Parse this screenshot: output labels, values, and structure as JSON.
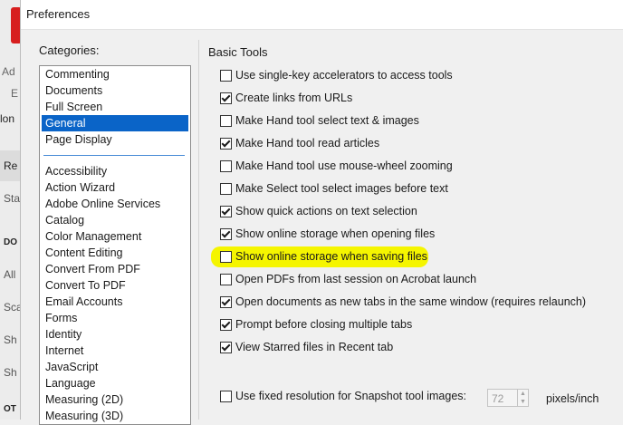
{
  "window": {
    "title": "Preferences"
  },
  "background_app": {
    "fragments": [
      "Ad",
      "E",
      "lon",
      "Re",
      "Sta",
      "DO",
      "All",
      "Sca",
      "Sh",
      "Sh",
      "OT"
    ]
  },
  "categories": {
    "label": "Categories:",
    "top_items": [
      {
        "label": "Commenting",
        "selected": false
      },
      {
        "label": "Documents",
        "selected": false
      },
      {
        "label": "Full Screen",
        "selected": false
      },
      {
        "label": "General",
        "selected": true
      },
      {
        "label": "Page Display",
        "selected": false
      }
    ],
    "items": [
      "Accessibility",
      "Action Wizard",
      "Adobe Online Services",
      "Catalog",
      "Color Management",
      "Content Editing",
      "Convert From PDF",
      "Convert To PDF",
      "Email Accounts",
      "Forms",
      "Identity",
      "Internet",
      "JavaScript",
      "Language",
      "Measuring (2D)",
      "Measuring (3D)"
    ]
  },
  "basic_tools": {
    "title": "Basic Tools",
    "options": [
      {
        "label": "Use single-key accelerators to access tools",
        "checked": false
      },
      {
        "label": "Create links from URLs",
        "checked": true
      },
      {
        "label": "Make Hand tool select text & images",
        "checked": false
      },
      {
        "label": "Make Hand tool read articles",
        "checked": true
      },
      {
        "label": "Make Hand tool use mouse-wheel zooming",
        "checked": false
      },
      {
        "label": "Make Select tool select images before text",
        "checked": false
      },
      {
        "label": "Show quick actions on text selection",
        "checked": true
      },
      {
        "label": "Show online storage when opening files",
        "checked": true
      },
      {
        "label": "Show online storage when saving files",
        "checked": false,
        "highlighted": true
      },
      {
        "label": "Open PDFs from last session on Acrobat launch",
        "checked": false
      },
      {
        "label": "Open documents as new tabs in the same window (requires relaunch)",
        "checked": true
      },
      {
        "label": "Prompt before closing multiple tabs",
        "checked": true
      },
      {
        "label": "View Starred files in Recent tab",
        "checked": true
      }
    ]
  },
  "snapshot": {
    "label": "Use fixed resolution for Snapshot tool images:",
    "checked": false,
    "value": "72",
    "units": "pixels/inch"
  },
  "colors": {
    "selection": "#0a64c8",
    "highlight": "#f5f500"
  }
}
